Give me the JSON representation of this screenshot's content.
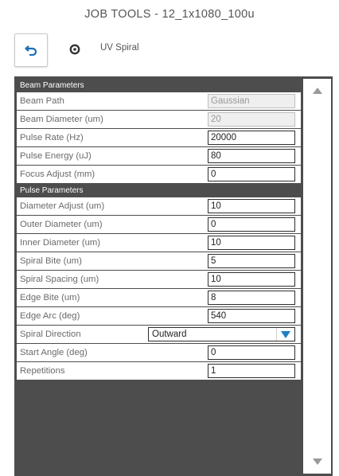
{
  "window": {
    "title": "JOB TOOLS - 12_1x1080_100u"
  },
  "toolbar": {
    "tool_name": "UV Spiral"
  },
  "sections": {
    "beam": {
      "header": "Beam Parameters",
      "beam_path": {
        "label": "Beam Path",
        "value": "Gaussian"
      },
      "beam_diameter": {
        "label": "Beam Diameter (um)",
        "value": "20"
      },
      "pulse_rate": {
        "label": "Pulse Rate (Hz)",
        "value": "20000"
      },
      "pulse_energy": {
        "label": "Pulse Energy (uJ)",
        "value": "80"
      },
      "focus_adjust": {
        "label": "Focus Adjust (mm)",
        "value": "0"
      }
    },
    "pulse": {
      "header": "Pulse Parameters",
      "diameter_adjust": {
        "label": "Diameter Adjust (um)",
        "value": "10"
      },
      "outer_diameter": {
        "label": "Outer Diameter (um)",
        "value": "0"
      },
      "inner_diameter": {
        "label": "Inner Diameter (um)",
        "value": "10"
      },
      "spiral_bite": {
        "label": "Spiral Bite (um)",
        "value": "5"
      },
      "spiral_spacing": {
        "label": "Spiral Spacing (um)",
        "value": "10"
      },
      "edge_bite": {
        "label": "Edge Bite (um)",
        "value": "8"
      },
      "edge_arc": {
        "label": "Edge Arc (deg)",
        "value": "540"
      },
      "spiral_direction": {
        "label": "Spiral Direction",
        "value": "Outward"
      },
      "start_angle": {
        "label": "Start Angle (deg)",
        "value": "0"
      },
      "repetitions": {
        "label": "Repetitions",
        "value": "1"
      }
    }
  },
  "icons": {
    "back": "undo-arrow-icon",
    "settings": "gear-icon",
    "scroll_up": "triangle-up-icon",
    "scroll_down": "triangle-down-icon",
    "dropdown": "triangle-down-icon"
  },
  "colors": {
    "accent": "#1b6fb5",
    "panel_header": "#4d4d4d",
    "dropdown_arrow": "#1d7fc4"
  }
}
